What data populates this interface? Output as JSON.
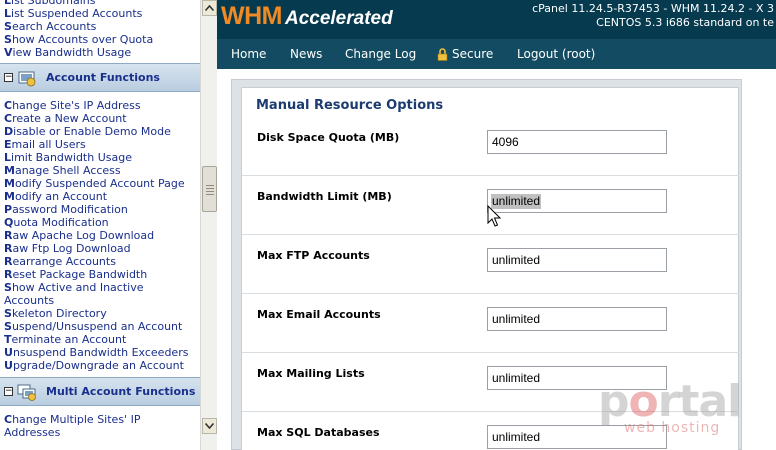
{
  "sidebar": {
    "top_links": [
      {
        "first": "L",
        "rest": "ist Subdomains"
      },
      {
        "first": "L",
        "rest": "ist Suspended Accounts"
      },
      {
        "first": "S",
        "rest": "earch Accounts"
      },
      {
        "first": "S",
        "rest": "how Accounts over Quota"
      },
      {
        "first": "V",
        "rest": "iew Bandwidth Usage"
      }
    ],
    "account_functions": {
      "title": "Account Functions",
      "collapse_symbol": "−",
      "links": [
        {
          "first": "C",
          "rest": "hange Site's IP Address"
        },
        {
          "first": "C",
          "rest": "reate a New Account"
        },
        {
          "first": "D",
          "rest": "isable or Enable Demo Mode"
        },
        {
          "first": "E",
          "rest": "mail all Users"
        },
        {
          "first": "L",
          "rest": "imit Bandwidth Usage"
        },
        {
          "first": "M",
          "rest": "anage Shell Access"
        },
        {
          "first": "M",
          "rest": "odify Suspended Account Page"
        },
        {
          "first": "M",
          "rest": "odify an Account"
        },
        {
          "first": "P",
          "rest": "assword Modification"
        },
        {
          "first": "Q",
          "rest": "uota Modification"
        },
        {
          "first": "R",
          "rest": "aw Apache Log Download"
        },
        {
          "first": "R",
          "rest": "aw Ftp Log Download"
        },
        {
          "first": "R",
          "rest": "earrange Accounts"
        },
        {
          "first": "R",
          "rest": "eset Package Bandwidth"
        },
        {
          "first": "S",
          "rest": "how Active and Inactive"
        },
        {
          "first": "",
          "rest": "Accounts"
        },
        {
          "first": "S",
          "rest": "keleton Directory"
        },
        {
          "first": "S",
          "rest": "uspend/Unsuspend an Account"
        },
        {
          "first": "T",
          "rest": "erminate an Account"
        },
        {
          "first": "U",
          "rest": "nsuspend Bandwidth Exceeders"
        },
        {
          "first": "U",
          "rest": "pgrade/Downgrade an Account"
        }
      ]
    },
    "multi_account_functions": {
      "title": "Multi Account Functions",
      "collapse_symbol": "−",
      "links": [
        {
          "first": "C",
          "rest": "hange Multiple Sites' IP"
        },
        {
          "first": "",
          "rest": "Addresses"
        }
      ]
    }
  },
  "header": {
    "logo_main": "WHM",
    "logo_sub": "Accelerated",
    "server_line1": "cPanel 11.24.5-R37453 - WHM 11.24.2 - X 3",
    "server_line2": "CENTOS 5.3 i686 standard on te"
  },
  "topnav": {
    "home": "Home",
    "news": "News",
    "changelog": "Change Log",
    "secure": "Secure",
    "logout": "Logout (root)"
  },
  "form": {
    "title": "Manual Resource Options",
    "rows": [
      {
        "label": "Disk Space Quota (MB)",
        "value": "4096"
      },
      {
        "label": "Bandwidth Limit (MB)",
        "value": "unlimited"
      },
      {
        "label": "Max FTP Accounts",
        "value": "unlimited"
      },
      {
        "label": "Max Email Accounts",
        "value": "unlimited"
      },
      {
        "label": "Max Mailing Lists",
        "value": "unlimited"
      },
      {
        "label": "Max SQL Databases",
        "value": "unlimited"
      }
    ]
  },
  "watermark": {
    "main_before": "p",
    "main_o": "o",
    "main_after": "rtal",
    "sub": "web hosting"
  },
  "colors": {
    "banner": "#063a4e",
    "nav": "#134c62",
    "logo_orange": "#f08a24",
    "link_blue": "#1a2f8c",
    "form_title": "#1c3c70"
  }
}
